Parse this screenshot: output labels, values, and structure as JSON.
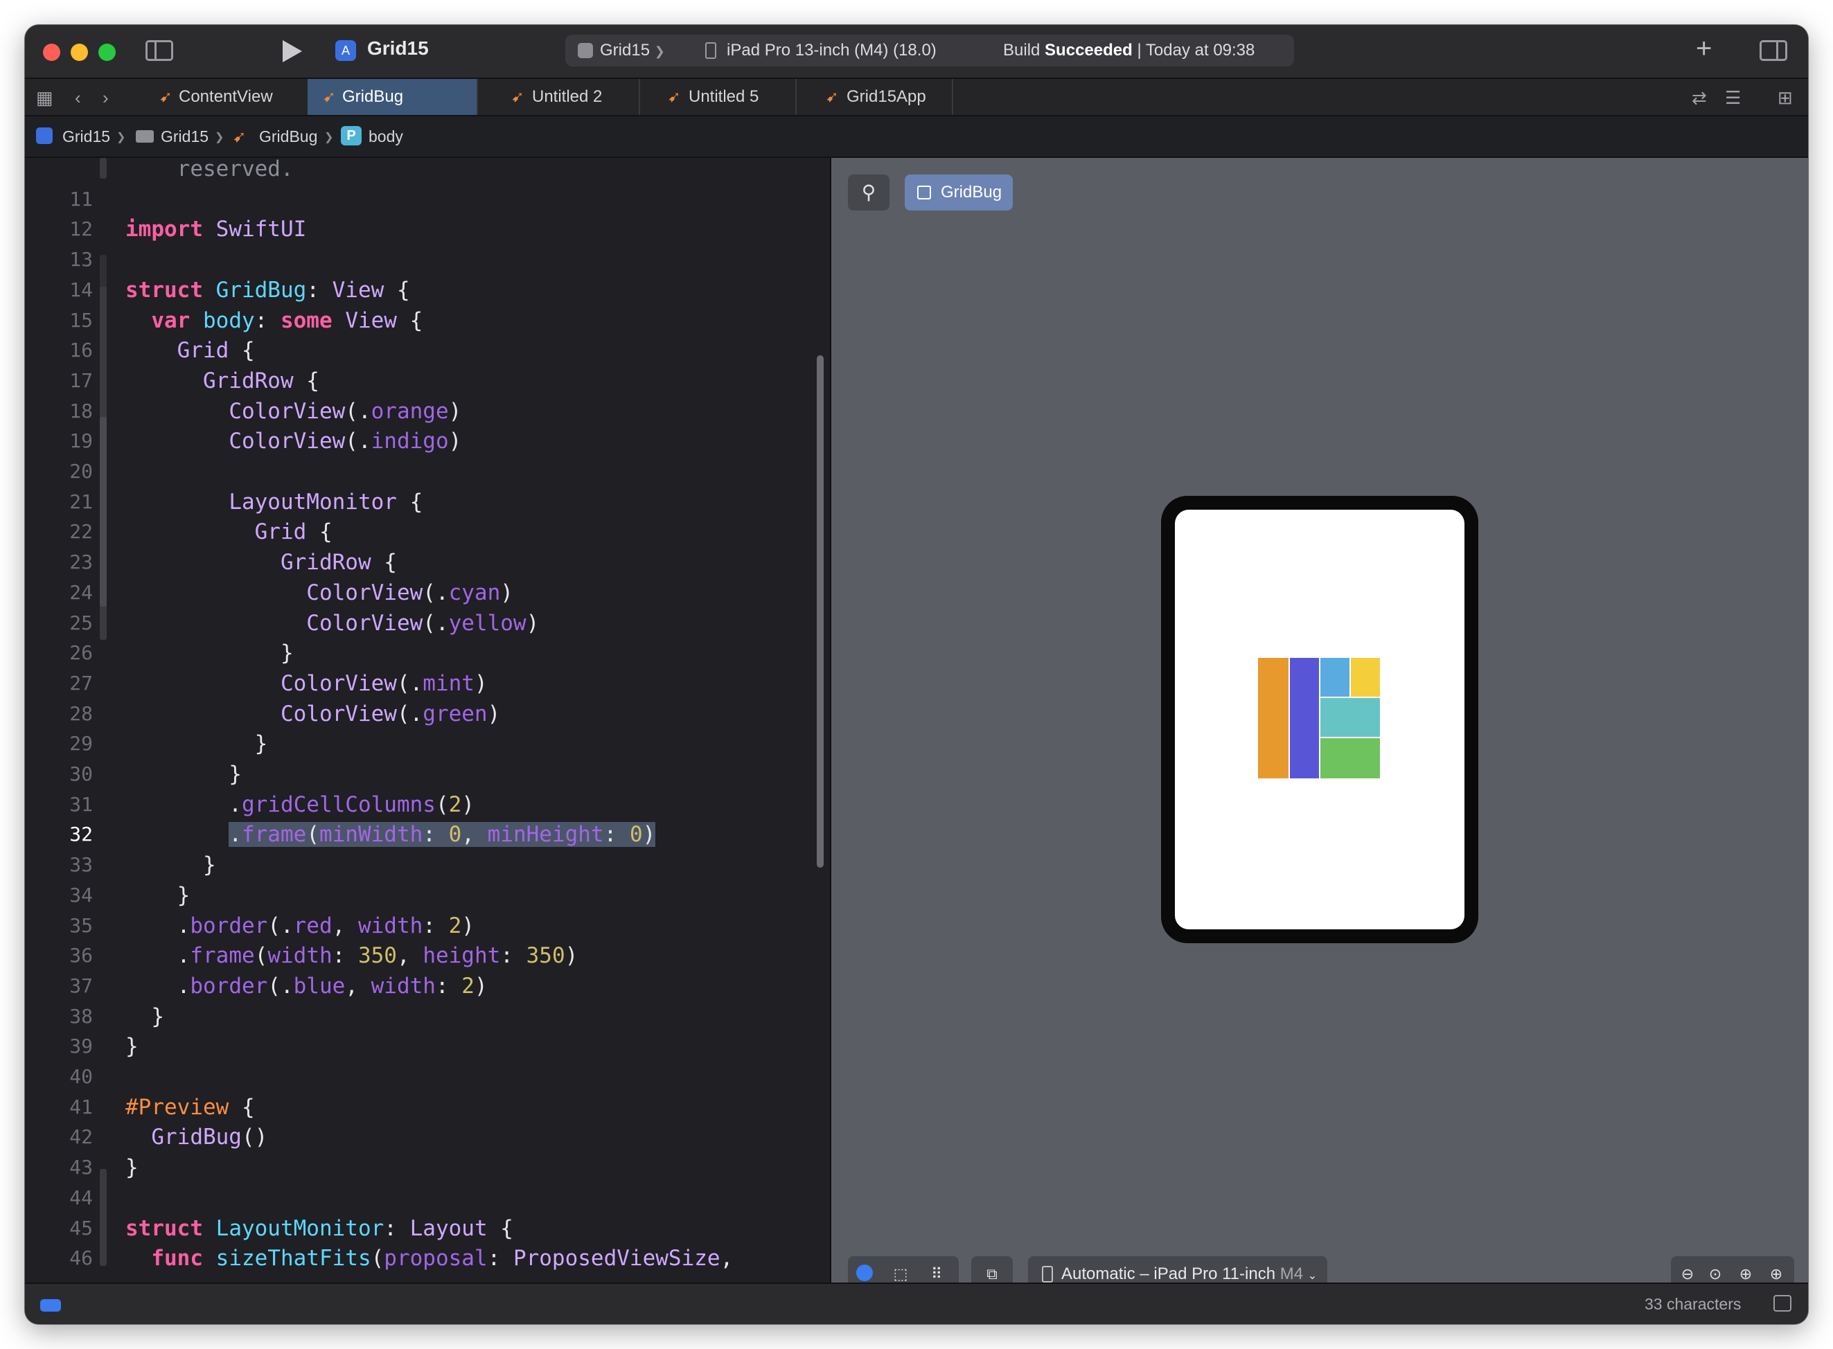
{
  "window": {
    "project_title": "Grid15",
    "scheme": "Grid15",
    "scheme_sep": "❯",
    "device": "iPad Pro 13-inch (M4) (18.0)",
    "build_status_prefix": "Build ",
    "build_status_bold": "Succeeded",
    "build_status_suffix": " | Today at 09:38"
  },
  "tabs": [
    {
      "label": "ContentView"
    },
    {
      "label": "GridBug",
      "active": true
    },
    {
      "label": "Untitled 2"
    },
    {
      "label": "Untitled 5"
    },
    {
      "label": "Grid15App"
    }
  ],
  "breadcrumb": {
    "items": [
      "Grid15",
      "Grid15",
      "GridBug",
      "body"
    ],
    "badge": "P",
    "separator": "❯"
  },
  "code_lines": [
    {
      "n": "",
      "text": "    reserved."
    },
    {
      "n": "11",
      "text": ""
    },
    {
      "n": "12",
      "text": "import SwiftUI"
    },
    {
      "n": "13",
      "text": ""
    },
    {
      "n": "14",
      "text": "struct GridBug: View {"
    },
    {
      "n": "15",
      "text": "  var body: some View {"
    },
    {
      "n": "16",
      "text": "    Grid {"
    },
    {
      "n": "17",
      "text": "      GridRow {"
    },
    {
      "n": "18",
      "text": "        ColorView(.orange)"
    },
    {
      "n": "19",
      "text": "        ColorView(.indigo)"
    },
    {
      "n": "20",
      "text": ""
    },
    {
      "n": "21",
      "text": "        LayoutMonitor {"
    },
    {
      "n": "22",
      "text": "          Grid {"
    },
    {
      "n": "23",
      "text": "            GridRow {"
    },
    {
      "n": "24",
      "text": "              ColorView(.cyan)"
    },
    {
      "n": "25",
      "text": "              ColorView(.yellow)"
    },
    {
      "n": "26",
      "text": "            }"
    },
    {
      "n": "27",
      "text": "            ColorView(.mint)"
    },
    {
      "n": "28",
      "text": "            ColorView(.green)"
    },
    {
      "n": "29",
      "text": "          }"
    },
    {
      "n": "30",
      "text": "        }"
    },
    {
      "n": "31",
      "text": "        .gridCellColumns(2)"
    },
    {
      "n": "32",
      "text": "        .frame(minWidth: 0, minHeight: 0)"
    },
    {
      "n": "33",
      "text": "      }"
    },
    {
      "n": "34",
      "text": "    }"
    },
    {
      "n": "35",
      "text": "    .border(.red, width: 2)"
    },
    {
      "n": "36",
      "text": "    .frame(width: 350, height: 350)"
    },
    {
      "n": "37",
      "text": "    .border(.blue, width: 2)"
    },
    {
      "n": "38",
      "text": "  }"
    },
    {
      "n": "39",
      "text": "}"
    },
    {
      "n": "40",
      "text": ""
    },
    {
      "n": "41",
      "text": "#Preview {"
    },
    {
      "n": "42",
      "text": "  GridBug()"
    },
    {
      "n": "43",
      "text": "}"
    },
    {
      "n": "44",
      "text": ""
    },
    {
      "n": "45",
      "text": "struct LayoutMonitor: Layout {"
    },
    {
      "n": "46",
      "text": "  func sizeThatFits(proposal: ProposedViewSize,"
    }
  ],
  "current_line": "32",
  "preview": {
    "pin_icon": "pin-icon",
    "preview_button_label": "GridBug",
    "device_select_label": "Automatic – iPad Pro 11-inch",
    "device_select_suffix": "M4",
    "cell_colors": {
      "orange": "#E8992E",
      "indigo": "#5856D6",
      "cyan": "#5AACE0",
      "yellow": "#F5CE3B",
      "mint": "#66C4C4",
      "green": "#6EC35E"
    }
  },
  "status_bar": {
    "char_count": "33 characters"
  },
  "colors": {
    "keyword": "#FC5FA3",
    "type": "#D0A8FF",
    "property": "#A167E6",
    "number": "#D0BF69",
    "accent": "#3B7CF0"
  }
}
